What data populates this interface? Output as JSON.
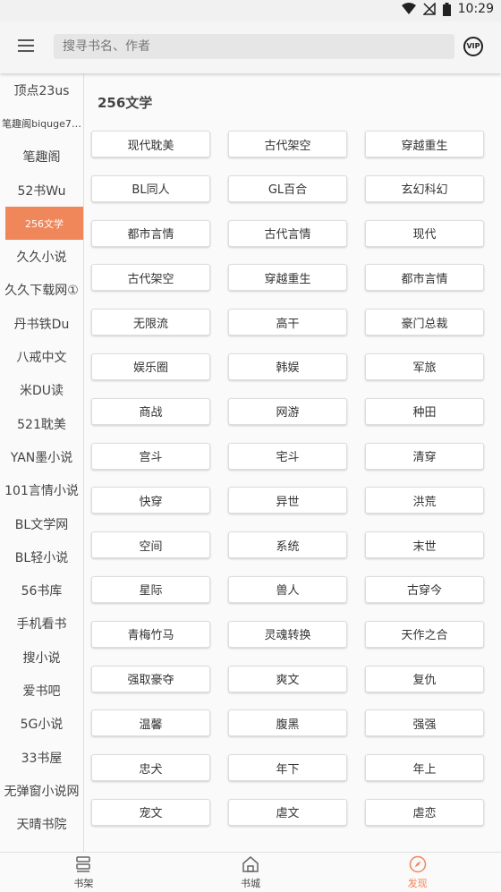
{
  "status": {
    "time": "10:29"
  },
  "header": {
    "search_placeholder": "搜寻书名、作者",
    "vip_label": "VIP"
  },
  "sidebar": {
    "items": [
      "顶点23us",
      "笔趣阁biquge7…",
      "笔趣阁",
      "52书Wu",
      "256文学",
      "久久小说",
      "久久下载网①",
      "丹书铁Du",
      "八戒中文",
      "米DU读",
      "521耽美",
      "YAN墨小说",
      "101言情小说",
      "BL文学网",
      "BL轻小说",
      "56书库",
      "手机看书",
      "搜小说",
      "爱书吧",
      "5G小说",
      "33书屋",
      "无弹窗小说网",
      "天晴书院"
    ],
    "active_index": 4
  },
  "main": {
    "title": "256文学",
    "tags": [
      "现代耽美",
      "古代架空",
      "穿越重生",
      "BL同人",
      "GL百合",
      "玄幻科幻",
      "都市言情",
      "古代言情",
      "现代",
      "古代架空",
      "穿越重生",
      "都市言情",
      "无限流",
      "高干",
      "豪门总裁",
      "娱乐圈",
      "韩娱",
      "军旅",
      "商战",
      "网游",
      "种田",
      "宫斗",
      "宅斗",
      "清穿",
      "快穿",
      "异世",
      "洪荒",
      "空间",
      "系统",
      "末世",
      "星际",
      "兽人",
      "古穿今",
      "青梅竹马",
      "灵魂转换",
      "天作之合",
      "强取豪夺",
      "爽文",
      "复仇",
      "温馨",
      "腹黑",
      "强强",
      "忠犬",
      "年下",
      "年上",
      "宠文",
      "虐文",
      "虐恋"
    ]
  },
  "bottom_nav": [
    {
      "label": "书架",
      "icon": "bookshelf-icon"
    },
    {
      "label": "书城",
      "icon": "home-icon"
    },
    {
      "label": "发现",
      "icon": "compass-icon"
    }
  ],
  "colors": {
    "accent": "#f0875a"
  }
}
